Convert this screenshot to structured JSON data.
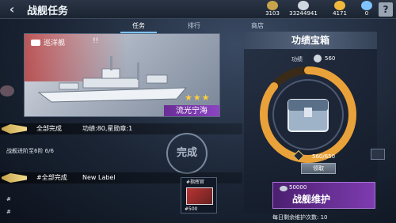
{
  "header": {
    "title": "战舰任务",
    "back_icon": "back-arrow-icon",
    "resources": [
      {
        "name": "medal",
        "icon": "medal-icon",
        "value": "3103",
        "color": "#c7a34b"
      },
      {
        "name": "silver",
        "icon": "silver-coin-icon",
        "value": "33244941",
        "color": "#cfd6df"
      },
      {
        "name": "gold",
        "icon": "gold-coin-icon",
        "value": "4171",
        "color": "#f0b93a"
      },
      {
        "name": "gem",
        "icon": "gem-icon",
        "value": "0",
        "color": "#7fc4ff"
      }
    ],
    "help_label": "?"
  },
  "tabs": [
    {
      "label": "任务",
      "active": true
    },
    {
      "label": "排行",
      "active": false
    },
    {
      "label": "商店",
      "active": false
    }
  ],
  "ship_card": {
    "type_label": "巡洋舰",
    "excl": "!!",
    "stars": "★★★",
    "name": "流光宁海"
  },
  "tasks": [
    {
      "status": "全部完成",
      "reward": "功绩:80,星勋章:1",
      "desc": "战舰进阶至6阶 6/6",
      "stamp": "完成"
    },
    {
      "status": "#全部完成",
      "reward": "New Label",
      "hash1": "#",
      "hash2": "#",
      "item_tag": "#指挥官",
      "item_count": "#500"
    }
  ],
  "chest": {
    "title": "功绩宝箱",
    "merit_label": "功绩",
    "merit_value": "560",
    "progress_text": "560/650",
    "progress": 0.86,
    "claim_label": "领取"
  },
  "maintenance": {
    "cost": "50000",
    "label": "战舰维护",
    "daily_text": "每日剩余维护次数: 10"
  },
  "colors": {
    "accent": "#7fc4ff",
    "purple": "#7e3cb0",
    "ring_orange": "#e9a23a",
    "gold": "#f2dc8d"
  }
}
